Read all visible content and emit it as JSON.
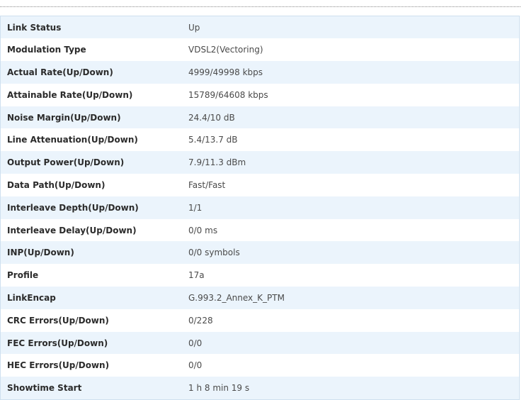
{
  "rows": [
    {
      "label": "Link Status",
      "value": "Up"
    },
    {
      "label": "Modulation Type",
      "value": "VDSL2(Vectoring)"
    },
    {
      "label": "Actual Rate(Up/Down)",
      "value": "4999/49998 kbps"
    },
    {
      "label": "Attainable Rate(Up/Down)",
      "value": "15789/64608 kbps"
    },
    {
      "label": "Noise Margin(Up/Down)",
      "value": "24.4/10 dB"
    },
    {
      "label": "Line Attenuation(Up/Down)",
      "value": "5.4/13.7 dB"
    },
    {
      "label": "Output Power(Up/Down)",
      "value": "7.9/11.3 dBm"
    },
    {
      "label": "Data Path(Up/Down)",
      "value": "Fast/Fast"
    },
    {
      "label": "Interleave Depth(Up/Down)",
      "value": "1/1"
    },
    {
      "label": "Interleave Delay(Up/Down)",
      "value": "0/0 ms"
    },
    {
      "label": "INP(Up/Down)",
      "value": "0/0 symbols"
    },
    {
      "label": "Profile",
      "value": "17a"
    },
    {
      "label": "LinkEncap",
      "value": "G.993.2_Annex_K_PTM"
    },
    {
      "label": "CRC Errors(Up/Down)",
      "value": "0/228"
    },
    {
      "label": "FEC Errors(Up/Down)",
      "value": "0/0"
    },
    {
      "label": "HEC Errors(Up/Down)",
      "value": "0/0"
    },
    {
      "label": "Showtime Start",
      "value": "1 h 8 min 19 s"
    }
  ]
}
